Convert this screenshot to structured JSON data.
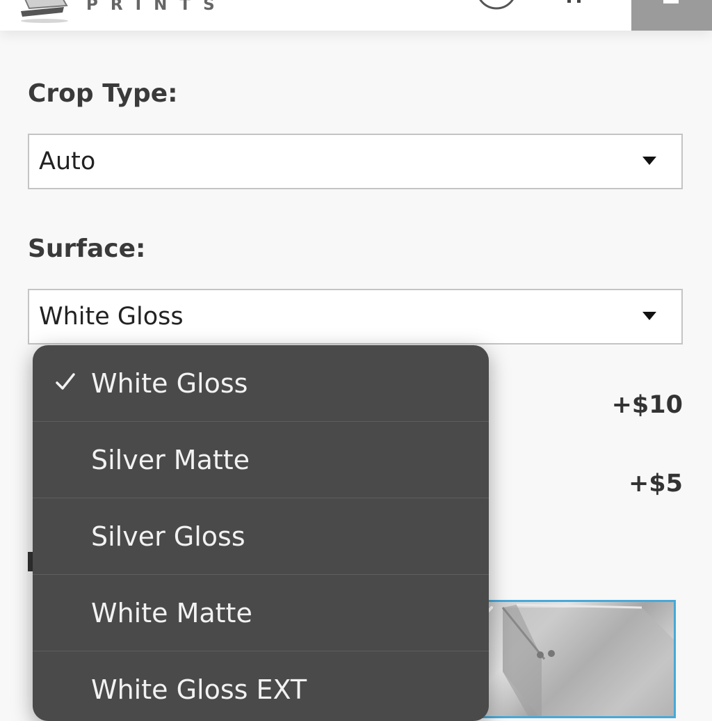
{
  "header": {
    "logo_text": "PRINTS",
    "account_icon": "account-icon",
    "cart_icon": "cart-icon",
    "menu_icon": "hamburger-menu-icon",
    "menu_color": "#9b9b9b"
  },
  "form": {
    "crop_type": {
      "label": "Crop Type:",
      "value": "Auto"
    },
    "surface": {
      "label": "Surface:",
      "value": "White Gloss"
    },
    "prices": [
      "+$10",
      "+$5"
    ]
  },
  "picker": {
    "selected_index": 0,
    "options": [
      {
        "label": "White Gloss",
        "selected": true
      },
      {
        "label": "Silver Matte",
        "selected": false
      },
      {
        "label": "Silver Gloss",
        "selected": false
      },
      {
        "label": "White Matte",
        "selected": false
      },
      {
        "label": "White Gloss EXT",
        "selected": false
      }
    ],
    "background": "#4a4a4a",
    "text_color": "#f2f2f2"
  },
  "product_image": {
    "border_color": "#46a9d9",
    "icon": "selected-check-icon"
  }
}
